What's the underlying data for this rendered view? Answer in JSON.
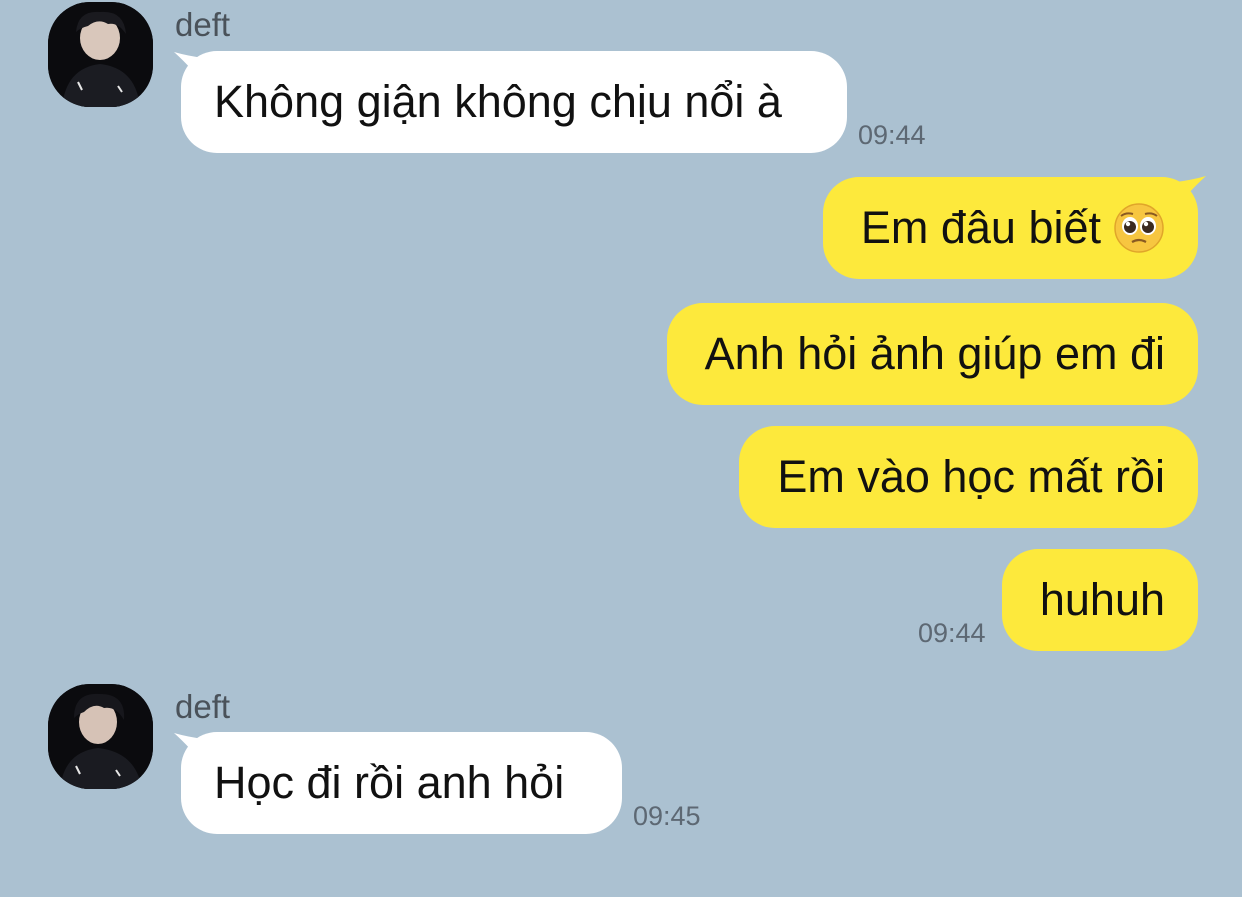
{
  "colors": {
    "background": "#abc1d1",
    "incoming_bubble": "#ffffff",
    "outgoing_bubble": "#fde93c"
  },
  "messages": [
    {
      "direction": "incoming",
      "sender": "deft",
      "text": "Không giận không chịu nổi à",
      "time": "09:44",
      "avatar": "profile-photo"
    },
    {
      "direction": "outgoing",
      "text": "Em đâu biết",
      "emoji": "pleading-face-emoji"
    },
    {
      "direction": "outgoing",
      "text": "Anh hỏi ảnh giúp em đi"
    },
    {
      "direction": "outgoing",
      "text": "Em vào học mất rồi"
    },
    {
      "direction": "outgoing",
      "text": "huhuh",
      "time": "09:44"
    },
    {
      "direction": "incoming",
      "sender": "deft",
      "text": "Học đi rồi anh hỏi",
      "time": "09:45",
      "avatar": "profile-photo"
    }
  ]
}
